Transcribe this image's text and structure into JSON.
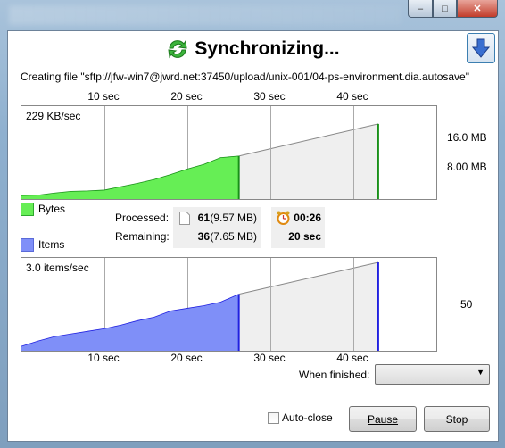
{
  "window": {
    "controls": {
      "minimize": "–",
      "maximize": "□",
      "close": "✕"
    }
  },
  "header": {
    "title": "Synchronizing...",
    "status": "Creating file \"sftp://jfw-win7@jwrd.net:37450/upload/unix-001/04-ps-environment.dia.autosave\""
  },
  "colors": {
    "bytes": "#66ee55",
    "bytes_line": "#189018",
    "items": "#7f8ff8",
    "items_line": "#2020e0",
    "projection": "#efefef"
  },
  "chart_data": [
    {
      "type": "area",
      "name": "Bytes",
      "x_ticks": [
        "10 sec",
        "20 sec",
        "30 sec",
        "40 sec"
      ],
      "y_ticks": [
        "16.0 MB",
        "8.00 MB"
      ],
      "rate": "229 KB/sec",
      "xlim": [
        0,
        50
      ],
      "ylim": [
        0,
        21
      ],
      "x": [
        0,
        2,
        4,
        6,
        8,
        10,
        12,
        14,
        16,
        18,
        20,
        22,
        24,
        26.2
      ],
      "y": [
        0.2,
        0.3,
        0.8,
        1.2,
        1.3,
        1.5,
        2.3,
        3.1,
        4.0,
        5.2,
        6.5,
        7.6,
        9.2,
        9.57
      ],
      "projection_end": {
        "x": 43,
        "y": 17.22
      }
    },
    {
      "type": "area",
      "name": "Items",
      "x_ticks": [
        "10 sec",
        "20 sec",
        "30 sec",
        "40 sec"
      ],
      "y_ticks": [
        "50"
      ],
      "rate": "3.0 items/sec",
      "xlim": [
        0,
        50
      ],
      "ylim": [
        0,
        102
      ],
      "x": [
        0,
        2,
        4,
        6,
        8,
        10,
        12,
        14,
        16,
        18,
        20,
        22,
        24,
        26.2
      ],
      "y": [
        2,
        8,
        13,
        16,
        19,
        22,
        26,
        31,
        35,
        42,
        45,
        48,
        52,
        61
      ],
      "projection_end": {
        "x": 43,
        "y": 97
      }
    }
  ],
  "stats": {
    "processed_label": "Processed:",
    "remaining_label": "Remaining:",
    "processed_count": "61",
    "processed_size": "(9.57 MB)",
    "remaining_count": "36",
    "remaining_size": "(7.65 MB)",
    "elapsed": "00:26",
    "remaining_time": "20 sec"
  },
  "footer": {
    "when_finished_label": "When finished:",
    "when_finished_value": "",
    "auto_close_label": "Auto-close",
    "auto_close_checked": false,
    "pause_label": "Pause",
    "stop_label": "Stop"
  }
}
